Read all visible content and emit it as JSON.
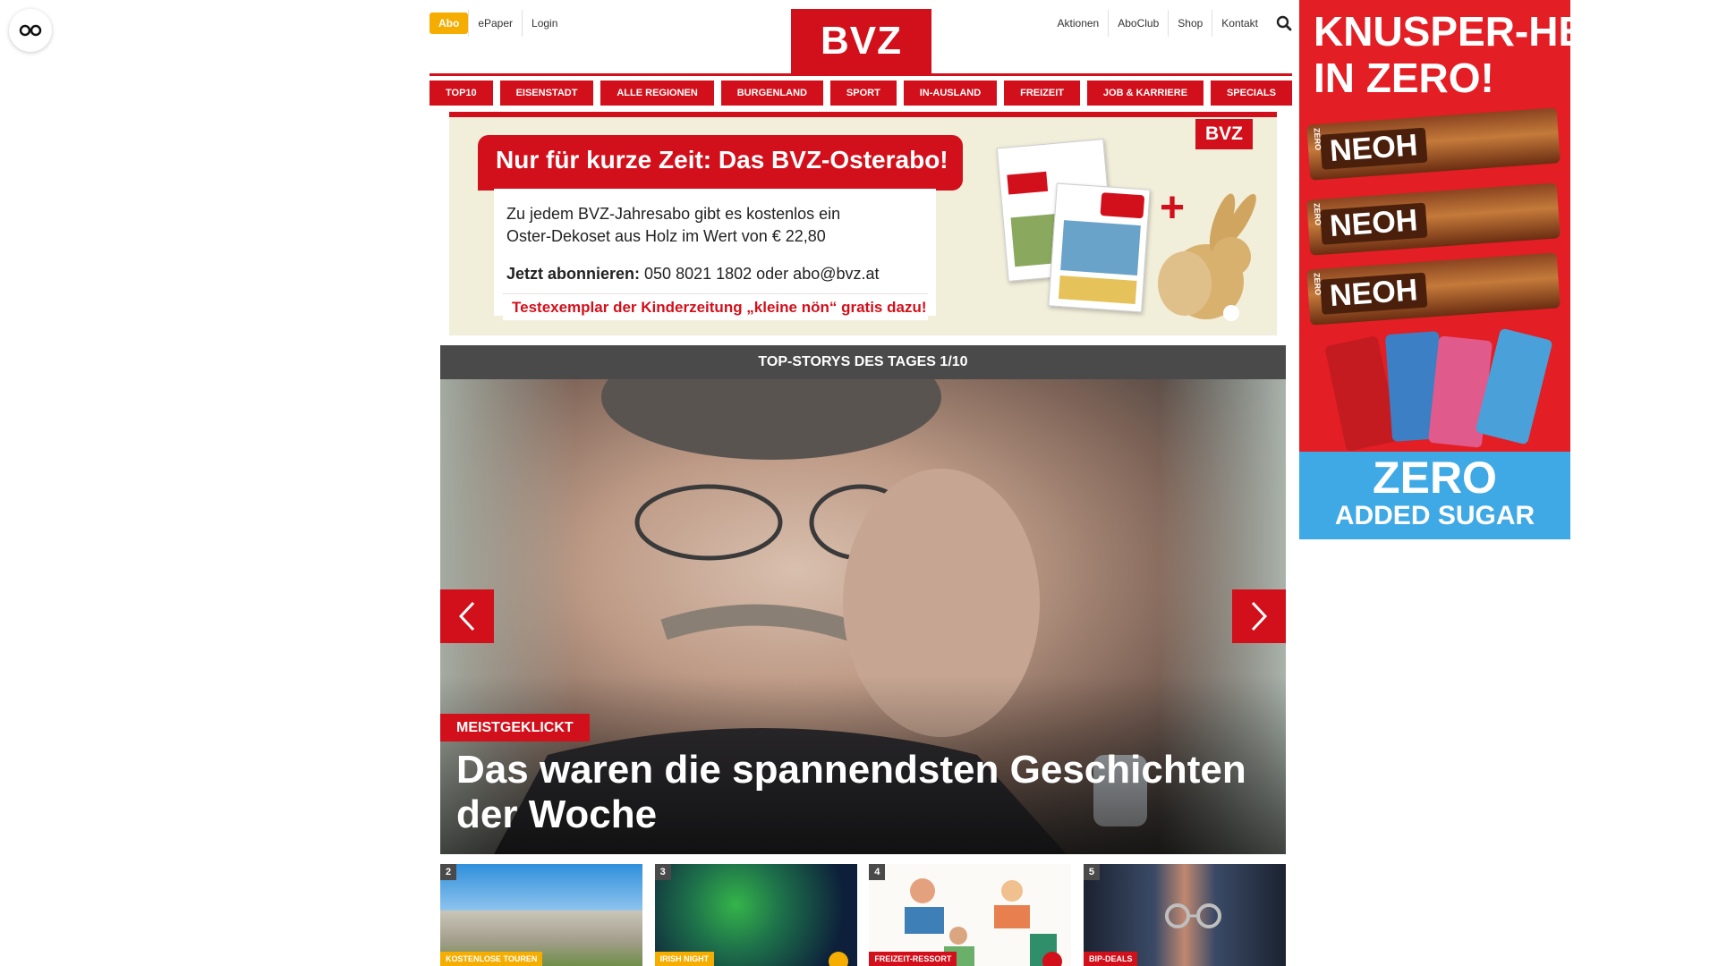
{
  "accessibility": {
    "icon": "glasses-icon"
  },
  "header": {
    "abo": "Abo",
    "left_links": [
      "ePaper",
      "Login"
    ],
    "logo": "BVZ",
    "right_links": [
      "Aktionen",
      "AboClub",
      "Shop",
      "Kontakt"
    ],
    "search_icon": "search-icon"
  },
  "nav": [
    "TOP10",
    "EISENSTADT",
    "ALLE REGIONEN",
    "BURGENLAND",
    "SPORT",
    "IN-AUSLAND",
    "FREIZEIT",
    "JOB & KARRIERE",
    "SPECIALS"
  ],
  "promo": {
    "title": "Nur für kurze Zeit: Das BVZ-Osterabo!",
    "line1": "Zu jedem BVZ-Jahresabo gibt es kostenlos ein",
    "line2": "Oster-Dekoset aus Holz im Wert von € 22,80",
    "contact_label": "Jetzt abonnieren:",
    "contact_text": " 050 8021 1802 oder abo@bvz.at",
    "footer": "Testexemplar der Kinderzeitung „kleine nön“ gratis dazu!",
    "logo": "BVZ",
    "plus": "+"
  },
  "stories": {
    "header": "TOP-STORYS DES TAGES 1/10",
    "hero_badge": "MEISTGEKLICKT",
    "hero_title": "Das waren die spannendsten Geschichten der Woche",
    "prev_icon": "chevron-left-icon",
    "next_icon": "chevron-right-icon",
    "thumbs": [
      {
        "num": "2",
        "category": "KOSTENLOSE TOUREN"
      },
      {
        "num": "3",
        "category": "IRISH NIGHT"
      },
      {
        "num": "4",
        "category": "FREIZEIT-RESSORT"
      },
      {
        "num": "5",
        "category": "BIP-DEALS"
      }
    ]
  },
  "ad": {
    "headline1": "KNUSPER-HERO",
    "headline2": "IN ZERO!",
    "brand": "NEOH",
    "tagline1": "ZERO",
    "tagline2": "ADDED SUGAR",
    "colors": {
      "bg": "#e31e24",
      "bottom": "#3fa9e5"
    }
  },
  "colors": {
    "brand_red": "#d2101b",
    "accent_yellow": "#f4ad00",
    "dark_header": "#4a4a4a"
  }
}
